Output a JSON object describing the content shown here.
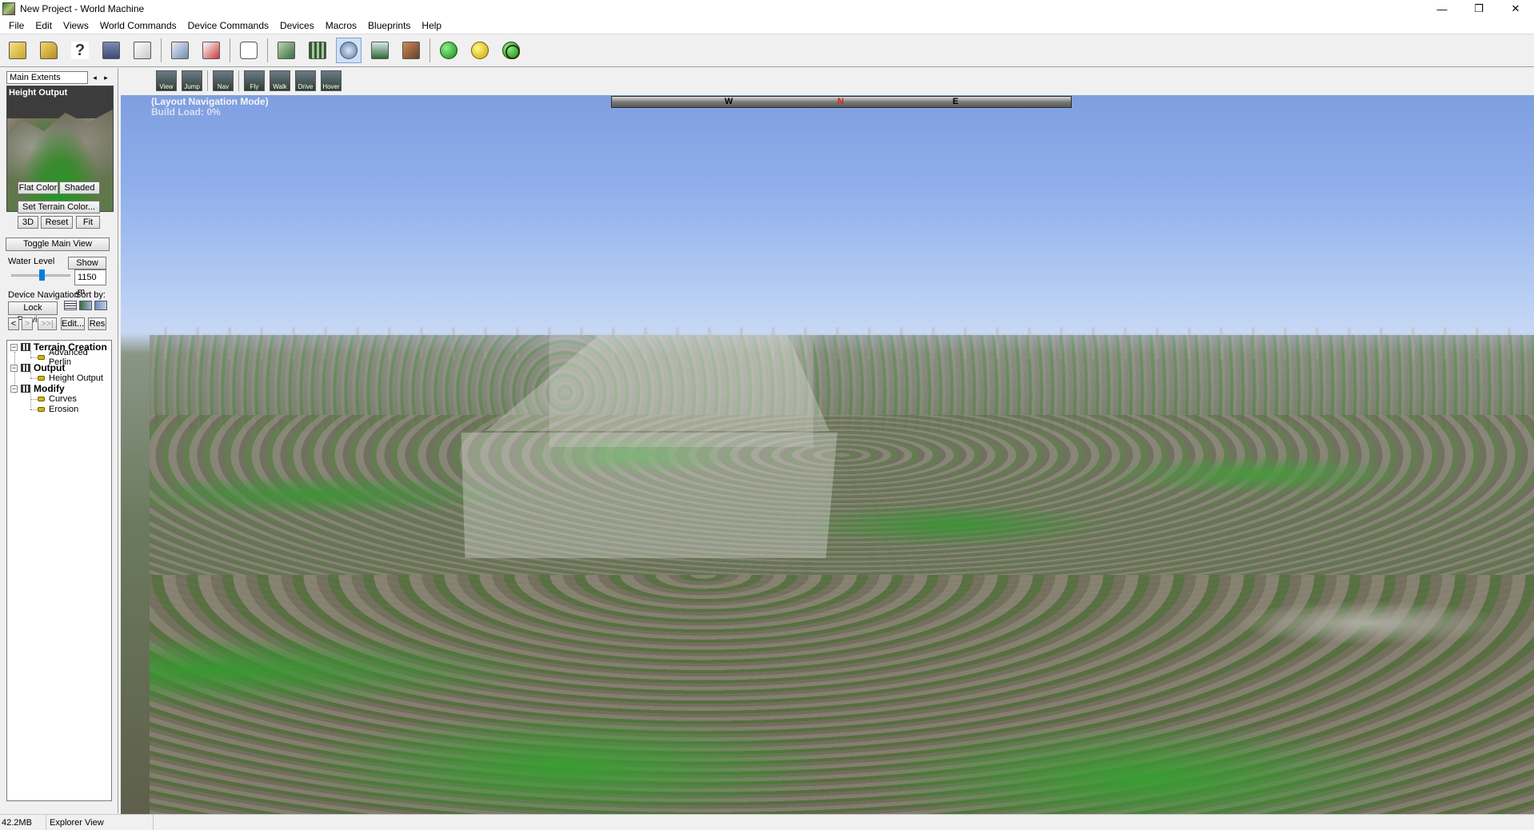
{
  "window": {
    "title": "New Project - World Machine",
    "controls": [
      "—",
      "❐",
      "✕"
    ]
  },
  "menu": [
    "File",
    "Edit",
    "Views",
    "World Commands",
    "Device Commands",
    "Devices",
    "Macros",
    "Blueprints",
    "Help"
  ],
  "toolbar": {
    "help_glyph": "?"
  },
  "view_toolbar": {
    "nav_labels": [
      "View",
      "Jump",
      "Nav",
      "Fly",
      "Walk",
      "Drive",
      "Hover"
    ]
  },
  "left_panel": {
    "extent_select": "Main Extents",
    "arrow_left": "◂",
    "arrow_right": "▸",
    "preview_label": "Height Output",
    "flat_color": "Flat Color",
    "shaded": "Shaded",
    "set_terrain_color": "Set Terrain Color...",
    "btn_3d": "3D",
    "btn_reset": "Reset",
    "btn_fit": "Fit",
    "toggle_main_view": "Toggle Main View",
    "water_level_label": "Water Level",
    "show": "Show",
    "water_level_value": "1150 m",
    "water_level_slider": 0.52,
    "device_navigation": "Device Navigation",
    "sort_by": "Sort by:",
    "lock_preview": "Lock Preview",
    "nav_prev": "<",
    "nav_next": ">",
    "nav_end": ">>|",
    "edit": "Edit...",
    "res": "Res"
  },
  "tree": [
    {
      "group": "Terrain Creation",
      "children": [
        "Advanced Perlin"
      ]
    },
    {
      "group": "Output",
      "children": [
        "Height Output"
      ]
    },
    {
      "group": "Modify",
      "children": [
        "Curves",
        "Erosion"
      ]
    }
  ],
  "tree_toggle": "−",
  "viewport": {
    "mode": "(Layout Navigation Mode)",
    "build_load": "Build Load: 0%",
    "compass_w": "W",
    "compass_n": "N",
    "compass_e": "E"
  },
  "status": {
    "memory": "42.2MB",
    "view": "Explorer View"
  }
}
